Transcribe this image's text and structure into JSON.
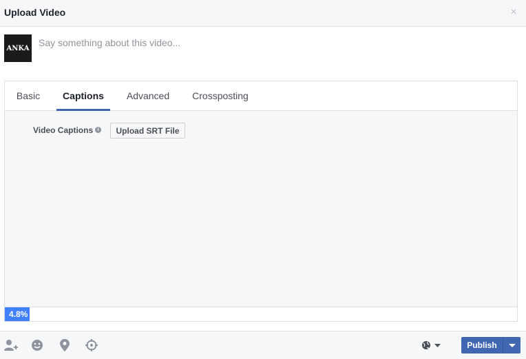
{
  "dialog": {
    "title": "Upload Video",
    "close_symbol": "×"
  },
  "composer": {
    "avatar_text": "ANKA",
    "placeholder": "Say something about this video..."
  },
  "tabs": [
    {
      "label": "Basic",
      "active": false
    },
    {
      "label": "Captions",
      "active": true
    },
    {
      "label": "Advanced",
      "active": false
    },
    {
      "label": "Crossposting",
      "active": false
    }
  ],
  "captions": {
    "label": "Video Captions",
    "info_symbol": "i",
    "upload_button": "Upload SRT File"
  },
  "upload_progress": {
    "percent": 4.8,
    "text": "4.8%"
  },
  "footer": {
    "icons": [
      "tag-friends-icon",
      "feeling-icon",
      "location-icon",
      "crosshair-icon"
    ],
    "privacy_icon": "globe-icon",
    "publish_label": "Publish"
  },
  "colors": {
    "accent": "#4267b2",
    "progress": "#4080ff"
  }
}
